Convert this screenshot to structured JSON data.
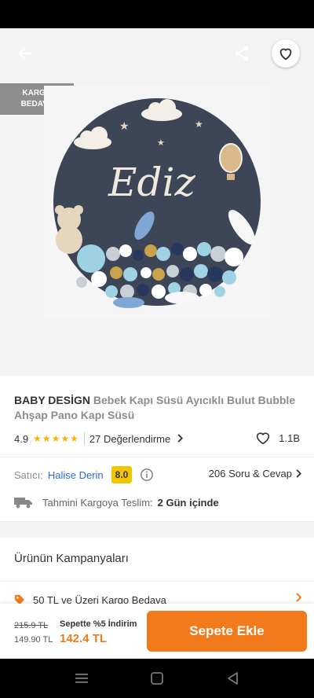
{
  "hero": {
    "cargo_badge_line1": "KARGO",
    "cargo_badge_line2": "BEDAVA",
    "image_text": "Ediz"
  },
  "product": {
    "brand": "BABY DESİGN",
    "name": "Bebek Kapı Süsü Ayıcıklı Bulut Bubble Ahşap Pano Kapı Süsü",
    "rating": "4.9",
    "stars": "★★★★★",
    "reviews": "27 Değerlendirme",
    "likes": "1.1B"
  },
  "seller": {
    "label": "Satıcı:",
    "name": "Halise Derin",
    "score": "8.0",
    "qa": "206 Soru & Cevap"
  },
  "delivery": {
    "label": "Tahmini Kargoya Teslim:",
    "value": "2 Gün içinde"
  },
  "campaign": {
    "title": "Ürünün Kampanyaları",
    "item": "50 TL ve Üzeri Kargo Bedava"
  },
  "price": {
    "old": "215.9 TL",
    "mid": "149.90 TL",
    "discount_label": "Sepette %5 İndirim",
    "final": "142.4 TL"
  },
  "actions": {
    "add_to_cart": "Sepete Ekle"
  },
  "colors": {
    "accent": "#f27a1a",
    "star": "#ffb100",
    "seller_link": "#2a6bd6",
    "score_badge": "#f2c500"
  }
}
